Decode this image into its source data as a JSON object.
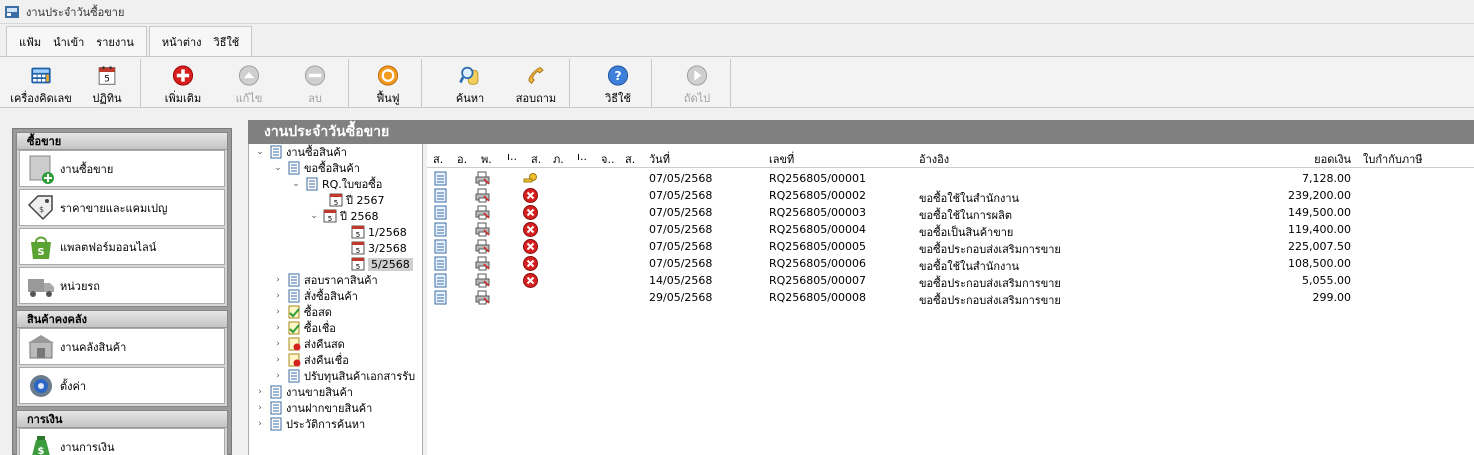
{
  "window": {
    "title": "งานประจำวันซื้อขาย"
  },
  "menu": {
    "group1": [
      "แฟ้ม",
      "นำเข้า",
      "รายงาน"
    ],
    "group2": [
      "หน้าต่าง",
      "วิธีใช้"
    ]
  },
  "toolbar": {
    "calculator": "เครื่องคิดเลข",
    "calendar": "ปฏิทิน",
    "add": "เพิ่มเติม",
    "edit": "แก้ไข",
    "delete": "ลบ",
    "restore": "ฟื้นฟู",
    "search": "ค้นหา",
    "inquiry": "สอบถาม",
    "help": "วิธีใช้",
    "next": "ถัดไป"
  },
  "sidebar": {
    "sections": [
      {
        "title": "ซื้อขาย",
        "items": [
          "งานซื้อขาย",
          "ราคาขายและแคมเปญ",
          "แพลตฟอร์มออนไลน์",
          "หน่วยรถ"
        ]
      },
      {
        "title": "สินค้าคงคลัง",
        "items": [
          "งานคลังสินค้า",
          "ตั้งค่า"
        ]
      },
      {
        "title": "การเงิน",
        "items": [
          "งานการเงิน"
        ]
      }
    ]
  },
  "main": {
    "title": "งานประจำวันซื้อขาย"
  },
  "tree": {
    "purchase": "งานซื้อสินค้า",
    "request": "ขอซื้อสินค้า",
    "rq": "RQ.ใบขอซื้อ",
    "y2567": "ปี 2567",
    "y2568": "ปี 2568",
    "m1": "1/2568",
    "m3": "3/2568",
    "m5": "5/2568",
    "quote": "สอบราคาสินค้า",
    "order": "สั่งซื้อสินค้า",
    "cash": "ซื้อสด",
    "credit": "ซื้อเชื่อ",
    "return_cash": "ส่งคืนสด",
    "return_credit": "ส่งคืนเชื่อ",
    "adjust": "ปรับทุนสินค้าเอกสารรับ",
    "sales": "งานขายสินค้า",
    "consign": "งานฝากขายสินค้า",
    "history": "ประวัติการค้นหา"
  },
  "grid": {
    "columns": [
      "ส.",
      "อ.",
      "พ.",
      "ı..",
      "ส.",
      "ภ.",
      "ı..",
      "จ..",
      "ส.",
      "วันที่",
      "เลขที่",
      "อ้างอิง",
      "ยอดเงิน",
      "ใบกำกับภาษี"
    ],
    "rows": [
      {
        "status": "key",
        "date": "07/05/2568",
        "no": "RQ256805/00001",
        "ref": "",
        "amount": "7,128.00"
      },
      {
        "status": "x",
        "date": "07/05/2568",
        "no": "RQ256805/00002",
        "ref": "ขอซื้อใช้ในสำนักงาน",
        "amount": "239,200.00"
      },
      {
        "status": "x",
        "date": "07/05/2568",
        "no": "RQ256805/00003",
        "ref": "ขอซื้อใช้ในการผลิต",
        "amount": "149,500.00"
      },
      {
        "status": "x",
        "date": "07/05/2568",
        "no": "RQ256805/00004",
        "ref": "ขอซื้อเป็นสินค้าขาย",
        "amount": "119,400.00"
      },
      {
        "status": "x",
        "date": "07/05/2568",
        "no": "RQ256805/00005",
        "ref": "ขอซื้อประกอบส่งเสริมการขาย",
        "amount": "225,007.50"
      },
      {
        "status": "x",
        "date": "07/05/2568",
        "no": "RQ256805/00006",
        "ref": "ขอซื้อใช้ในสำนักงาน",
        "amount": "108,500.00"
      },
      {
        "status": "x",
        "date": "14/05/2568",
        "no": "RQ256805/00007",
        "ref": "ขอซื้อประกอบส่งเสริมการขาย",
        "amount": "5,055.00"
      },
      {
        "status": "",
        "date": "29/05/2568",
        "no": "RQ256805/00008",
        "ref": "ขอซื้อประกอบส่งเสริมการขาย",
        "amount": "299.00"
      }
    ]
  }
}
